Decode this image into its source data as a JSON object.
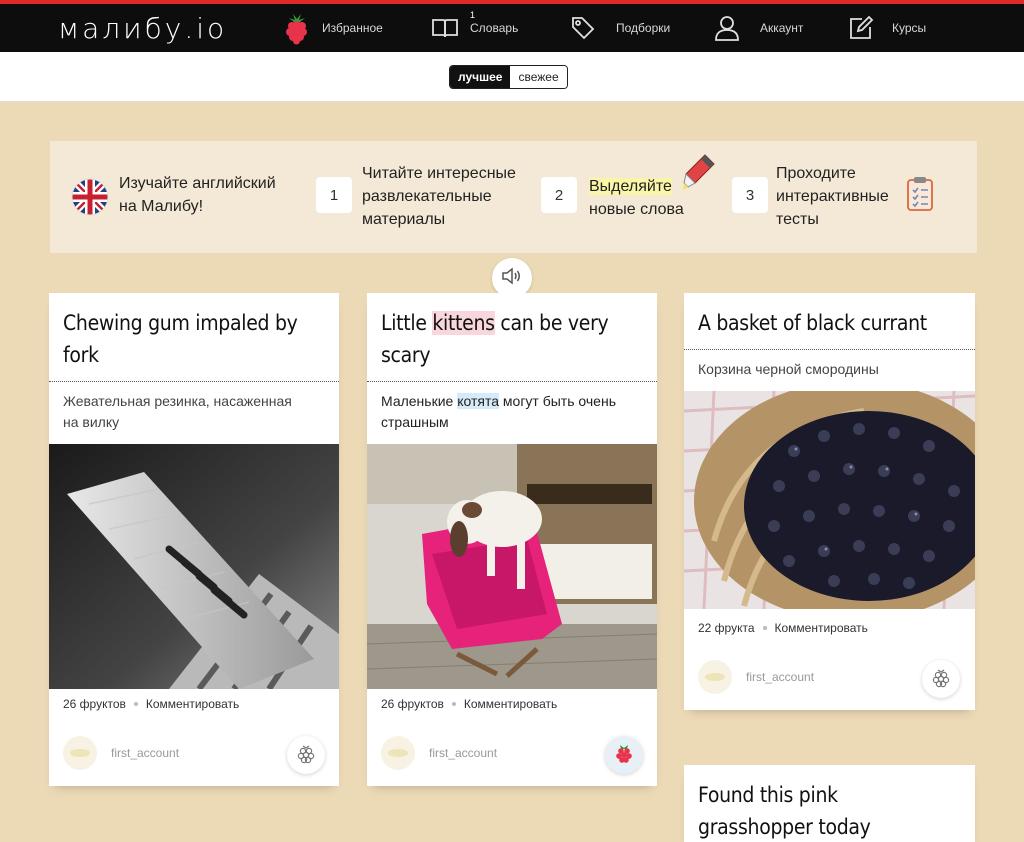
{
  "header": {
    "logo": "малибу.io",
    "nav": [
      {
        "label": "Избранное",
        "icon": "raspberry-icon"
      },
      {
        "label": "Словарь",
        "icon": "book-icon",
        "badge": "1"
      },
      {
        "label": "Подборки",
        "icon": "tag-icon"
      },
      {
        "label": "Аккаунт",
        "icon": "user-icon"
      },
      {
        "label": "Курсы",
        "icon": "edit-icon"
      }
    ]
  },
  "filter": {
    "best": "лучшее",
    "fresh": "свежее",
    "active": "best"
  },
  "banner": {
    "intro": [
      "Изучайте английский",
      "на Малибу!"
    ],
    "steps": [
      {
        "num": "1",
        "lines": [
          "Читайте интересные",
          "развлекательные",
          "материалы"
        ]
      },
      {
        "num": "2",
        "highlight": "Выделяйте",
        "rest": "новые слова"
      },
      {
        "num": "3",
        "lines": [
          "Проходите",
          "интерактивные",
          "тесты"
        ]
      }
    ]
  },
  "cards": [
    {
      "title": [
        "Chewing gum impaled by",
        "fork"
      ],
      "subtitle": [
        "Жевательная резинка, насаженная",
        "на вилку"
      ],
      "fruits": "26 фруктов",
      "comment": "Комментировать",
      "author": "first_account",
      "liked": false
    },
    {
      "title_pre": "Little ",
      "title_hl": "kittens",
      "title_post": " can be very",
      "title_line2": "scary",
      "sub_pre": "Маленькие ",
      "sub_hl": "котята",
      "sub_post": " могут быть очень",
      "sub_line2": "страшным",
      "fruits": "26 фруктов",
      "comment": "Комментировать",
      "author": "first_account",
      "liked": true
    },
    {
      "title": [
        "A basket of black currant"
      ],
      "subtitle": [
        "Корзина черной смородины"
      ],
      "fruits": "22 фрукта",
      "comment": "Комментировать",
      "author": "first_account",
      "liked": false
    },
    {
      "title": [
        "Found this pink",
        "grasshopper today"
      ]
    }
  ],
  "colors": {
    "accent": "#e02a2a",
    "background": "#ecd9b6",
    "topbar": "#0d0d0d"
  }
}
